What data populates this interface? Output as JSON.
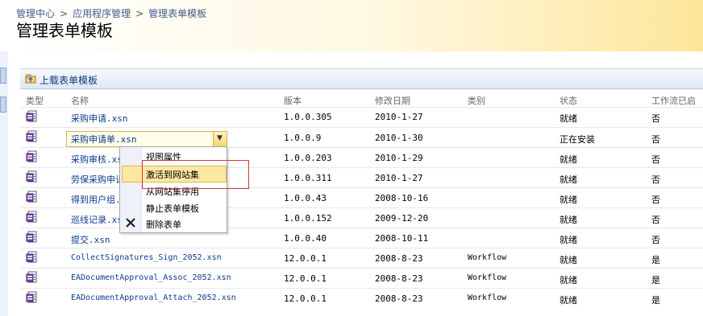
{
  "breadcrumb": {
    "item1": "管理中心",
    "item2": "应用程序管理",
    "current": "管理表单模板",
    "sep": ">"
  },
  "page_title": "管理表单模板",
  "toolbar": {
    "upload_label": "上载表单模板"
  },
  "columns": {
    "type": "类型",
    "name": "名称",
    "version": "版本",
    "modified": "修改日期",
    "category": "类别",
    "status": "状态",
    "workflow": "工作流已启"
  },
  "rows": [
    {
      "name": "采购申请.xsn",
      "version": "1.0.0.305",
      "modified": "2010-1-27",
      "category": "",
      "status": "就绪",
      "workflow": "否"
    },
    {
      "name": "采购申请单.xsn",
      "version": "1.0.0.9",
      "modified": "2010-1-30",
      "category": "",
      "status": "正在安装",
      "workflow": "否"
    },
    {
      "name": "采购审核.xsn",
      "version": "1.0.0.203",
      "modified": "2010-1-29",
      "category": "",
      "status": "就绪",
      "workflow": "否"
    },
    {
      "name": "劳保采购申请.xsn",
      "version": "1.0.0.311",
      "modified": "2010-1-27",
      "category": "",
      "status": "就绪",
      "workflow": "否"
    },
    {
      "name": "得到用户组.xsn",
      "version": "1.0.0.43",
      "modified": "2008-10-16",
      "category": "",
      "status": "就绪",
      "workflow": "否"
    },
    {
      "name": "巡线记录.xsn",
      "version": "1.0.0.152",
      "modified": "2009-12-20",
      "category": "",
      "status": "就绪",
      "workflow": "否"
    },
    {
      "name": "提交.xsn",
      "version": "1.0.0.40",
      "modified": "2008-10-11",
      "category": "",
      "status": "就绪",
      "workflow": "否"
    },
    {
      "name": "CollectSignatures_Sign_2052.xsn",
      "version": "12.0.0.1",
      "modified": "2008-8-23",
      "category": "Workflow",
      "status": "就绪",
      "workflow": "是"
    },
    {
      "name": "EADocumentApproval_Assoc_2052.xsn",
      "version": "12.0.0.1",
      "modified": "2008-8-23",
      "category": "Workflow",
      "status": "就绪",
      "workflow": "是"
    },
    {
      "name": "EADocumentApproval_Attach_2052.xsn",
      "version": "12.0.0.1",
      "modified": "2008-8-23",
      "category": "Workflow",
      "status": "就绪",
      "workflow": "是"
    }
  ],
  "context_menu": {
    "items": [
      "视图属性",
      "激活到网站集",
      "从网站集停用",
      "静止表单模板",
      "删除表单"
    ],
    "highlighted_index": 1
  },
  "colors": {
    "link": "#0b3a8e",
    "header_accent": "#fde69a",
    "highlight": "#fce7a3",
    "annotation": "#d23a3a"
  }
}
